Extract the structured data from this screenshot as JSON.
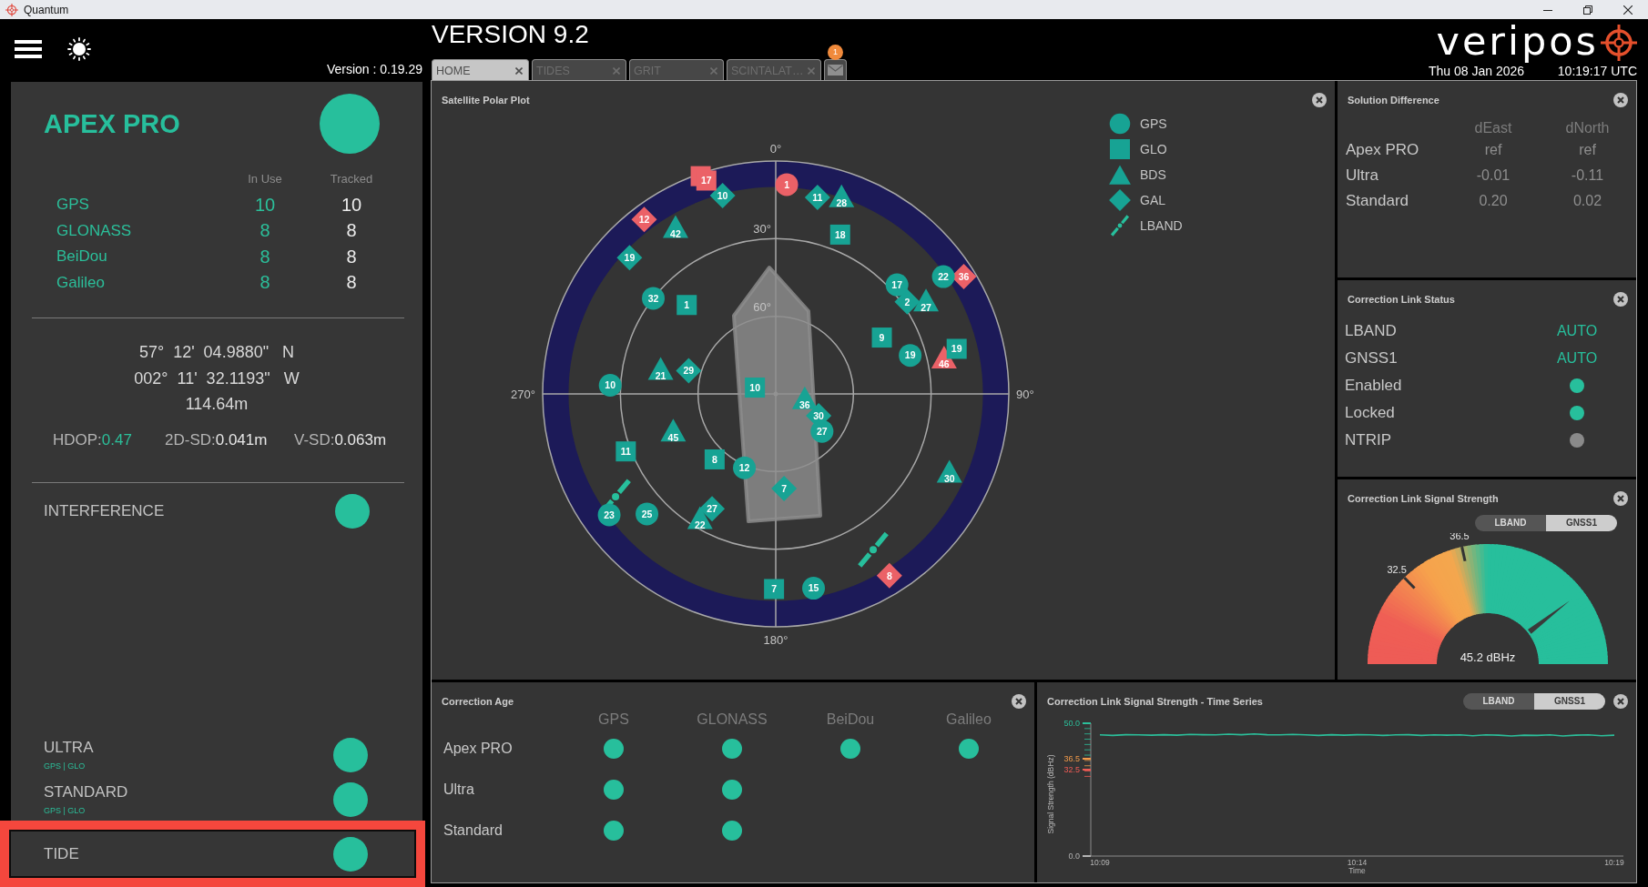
{
  "window": {
    "title": "Quantum"
  },
  "header": {
    "version": "Version : 0.19.29",
    "title": "VERSION 9.2",
    "tabs": [
      {
        "label": "HOME",
        "selected": true
      },
      {
        "label": "TIDES",
        "selected": false
      },
      {
        "label": "GRIT",
        "selected": false
      },
      {
        "label": "SCINTALAT…",
        "selected": false
      }
    ],
    "messages": {
      "badge": "1"
    },
    "logo": "veripos",
    "date": "Thu 08 Jan 2026",
    "time": "10:19:17 UTC"
  },
  "receiver": {
    "name": "APEX PRO",
    "on": true,
    "columns": [
      "In Use",
      "Tracked"
    ],
    "constellations": [
      {
        "name": "GPS",
        "in_use": "10",
        "tracked": "10"
      },
      {
        "name": "GLONASS",
        "in_use": "8",
        "tracked": "8"
      },
      {
        "name": "BeiDou",
        "in_use": "8",
        "tracked": "8"
      },
      {
        "name": "Galileo",
        "in_use": "8",
        "tracked": "8"
      }
    ],
    "position": [
      "57°  12'  04.9880\"   N",
      "002°  11'  32.1193\"   W",
      "114.64m"
    ],
    "metrics": [
      {
        "label": "HDOP:",
        "value": "0.47",
        "color": "#2bbf9a"
      },
      {
        "label": "2D-SD:",
        "value": "0.041m",
        "color": "#e6e6e6"
      },
      {
        "label": "V-SD:",
        "value": "0.063m",
        "color": "#e6e6e6"
      }
    ]
  },
  "interference": {
    "name": "INTERFERENCE",
    "on": true
  },
  "services": [
    {
      "name": "ULTRA",
      "systems": "GPS | GLO",
      "on": true
    },
    {
      "name": "STANDARD",
      "systems": "GPS | GLO",
      "on": true
    }
  ],
  "tide": {
    "name": "TIDE",
    "on": true,
    "highlighted": true
  },
  "polar": {
    "title": "Satellite Polar Plot",
    "azimuth_labels": [
      "0°",
      "90°",
      "180°",
      "270°"
    ],
    "elevation_labels": [
      "30°",
      "60°"
    ],
    "legend": [
      {
        "label": "GPS",
        "kind": "circle",
        "color": "#17a394"
      },
      {
        "label": "GLO",
        "kind": "square",
        "color": "#17a394"
      },
      {
        "label": "BDS",
        "kind": "triangle",
        "color": "#17a394"
      },
      {
        "label": "GAL",
        "kind": "diamond",
        "color": "#17a394"
      },
      {
        "label": "LBAND",
        "kind": "satellite",
        "color": "#27bf9c"
      }
    ],
    "satellites": [
      {
        "kind": "square",
        "color": "#eb6167"
      },
      {
        "kind": "satellite",
        "color": "#27bf9c"
      },
      {
        "kind": "satellite",
        "color": "#27bf9c"
      },
      {
        "kind": "diamond",
        "label": "12",
        "color": "#eb6167"
      },
      {
        "kind": "diamond",
        "label": "36",
        "color": "#eb6167"
      },
      {
        "kind": "diamond",
        "label": "8",
        "color": "#eb6167"
      },
      {
        "kind": "diamond",
        "label": "10",
        "color": "#17a394"
      },
      {
        "kind": "diamond",
        "label": "11",
        "color": "#17a394"
      },
      {
        "kind": "diamond",
        "label": "19",
        "color": "#17a394"
      },
      {
        "kind": "diamond",
        "label": "2",
        "color": "#17a394"
      },
      {
        "kind": "diamond",
        "label": "29",
        "color": "#17a394"
      },
      {
        "kind": "diamond",
        "label": "30",
        "color": "#17a394"
      },
      {
        "kind": "diamond",
        "label": "7",
        "color": "#17a394"
      },
      {
        "kind": "diamond",
        "label": "27",
        "color": "#17a394"
      },
      {
        "kind": "triangle",
        "label": "46",
        "color": "#eb6167"
      },
      {
        "kind": "triangle",
        "label": "28",
        "color": "#17a394"
      },
      {
        "kind": "triangle",
        "label": "42",
        "color": "#17a394"
      },
      {
        "kind": "triangle",
        "label": "27",
        "color": "#17a394"
      },
      {
        "kind": "triangle",
        "label": "21",
        "color": "#17a394"
      },
      {
        "kind": "triangle",
        "label": "36",
        "color": "#17a394"
      },
      {
        "kind": "triangle",
        "label": "45",
        "color": "#17a394"
      },
      {
        "kind": "triangle",
        "label": "22",
        "color": "#17a394"
      },
      {
        "kind": "triangle",
        "label": "30",
        "color": "#17a394"
      },
      {
        "kind": "square",
        "label": "17",
        "color": "#eb6167"
      },
      {
        "kind": "square",
        "label": "18",
        "color": "#17a394"
      },
      {
        "kind": "square",
        "label": "1",
        "color": "#17a394"
      },
      {
        "kind": "square",
        "label": "9",
        "color": "#17a394"
      },
      {
        "kind": "square",
        "label": "19",
        "color": "#17a394"
      },
      {
        "kind": "square",
        "label": "10",
        "color": "#17a394"
      },
      {
        "kind": "square",
        "label": "11",
        "color": "#17a394"
      },
      {
        "kind": "square",
        "label": "8",
        "color": "#17a394"
      },
      {
        "kind": "square",
        "label": "7",
        "color": "#17a394"
      },
      {
        "kind": "circle",
        "label": "1",
        "color": "#eb6167"
      },
      {
        "kind": "circle",
        "label": "32",
        "color": "#17a394"
      },
      {
        "kind": "circle",
        "label": "17",
        "color": "#17a394"
      },
      {
        "kind": "circle",
        "label": "22",
        "color": "#17a394"
      },
      {
        "kind": "circle",
        "label": "19",
        "color": "#17a394"
      },
      {
        "kind": "circle",
        "label": "10",
        "color": "#17a394"
      },
      {
        "kind": "circle",
        "label": "27",
        "color": "#17a394"
      },
      {
        "kind": "circle",
        "label": "12",
        "color": "#17a394"
      },
      {
        "kind": "circle",
        "label": "23",
        "color": "#17a394"
      },
      {
        "kind": "circle",
        "label": "25",
        "color": "#17a394"
      },
      {
        "kind": "circle",
        "label": "15",
        "color": "#17a394"
      }
    ]
  },
  "solution_difference": {
    "title": "Solution Difference",
    "columns": [
      "dEast",
      "dNorth"
    ],
    "rows": [
      {
        "label": "Apex PRO",
        "values": [
          "ref",
          "ref"
        ]
      },
      {
        "label": "Ultra",
        "values": [
          "-0.01",
          "-0.11"
        ]
      },
      {
        "label": "Standard",
        "values": [
          "0.20",
          "0.02"
        ]
      }
    ]
  },
  "link_status": {
    "title": "Correction Link Status",
    "rows": [
      {
        "kind": "text",
        "label": "LBAND",
        "value": "AUTO"
      },
      {
        "kind": "text",
        "label": "GNSS1",
        "value": "AUTO"
      },
      {
        "kind": "dot",
        "label": "Enabled",
        "on": true
      },
      {
        "kind": "dot",
        "label": "Locked",
        "on": true
      },
      {
        "kind": "dot",
        "label": "NTRIP",
        "on": false
      }
    ]
  },
  "signal_strength": {
    "title": "Correction Link Signal Strength",
    "sources": [
      {
        "label": "LBAND",
        "selected": false
      },
      {
        "label": "GNSS1",
        "selected": true
      }
    ],
    "gauge": {
      "level": 0.79,
      "reading": "45.2 dBHz",
      "ticks": [
        {
          "label": "32.5",
          "level": 0.256
        },
        {
          "label": "36.5",
          "level": 0.431
        }
      ]
    }
  },
  "correction_age": {
    "title": "Correction Age",
    "columns": [
      "GPS",
      "GLONASS",
      "BeiDou",
      "Galileo"
    ],
    "rows": [
      {
        "label": "Apex PRO",
        "cells": [
          {
            "on": true
          },
          {
            "on": true
          },
          {
            "on": true
          },
          {
            "on": true
          }
        ]
      },
      {
        "label": "Ultra",
        "cells": [
          {
            "on": true
          },
          {
            "on": true
          },
          {
            "on": false
          },
          {
            "on": false
          }
        ]
      },
      {
        "label": "Standard",
        "cells": [
          {
            "on": true
          },
          {
            "on": true
          },
          {
            "on": false
          },
          {
            "on": false
          }
        ]
      }
    ]
  },
  "time_series": {
    "title": "Correction Link Signal Strength - Time Series",
    "sources": [
      {
        "label": "LBAND",
        "selected": false
      },
      {
        "label": "GNSS1",
        "selected": true
      }
    ],
    "ytick_marks": [
      {
        "color": "#2bbf9a"
      },
      {
        "color": "#f29a4a"
      },
      {
        "color": "#ee5b55"
      },
      {
        "color": "#b4b4b4"
      }
    ],
    "chart_data": {
      "type": "line",
      "xlabel": "Time",
      "ylabel": "Signal Strength (dBHz)",
      "categories": [
        "10:09",
        null,
        null,
        null,
        null,
        null,
        null,
        null,
        null,
        null,
        null,
        null,
        null,
        null,
        null,
        null,
        null,
        null,
        null,
        null,
        "10:14",
        null,
        null,
        null,
        null,
        null,
        null,
        null,
        null,
        null,
        null,
        null,
        null,
        null,
        null,
        null,
        null,
        null,
        null,
        null,
        "10:19"
      ],
      "ylim": [
        0,
        50
      ],
      "yticks": [
        {
          "value": 50,
          "label": "50.0"
        },
        {
          "value": 36.5,
          "label": "36.5"
        },
        {
          "value": 32.5,
          "label": "32.5"
        },
        {
          "value": 0,
          "label": "0.0"
        }
      ],
      "series": [
        {
          "color": "#2bbf9a",
          "values": [
            45.6,
            45.4,
            45.7,
            45.6,
            45.5,
            45.7,
            45.5,
            45.8,
            45.7,
            45.6,
            45.9,
            45.7,
            46.0,
            45.7,
            45.6,
            45.8,
            45.6,
            45.4,
            45.7,
            45.5,
            45.7,
            45.6,
            45.4,
            45.6,
            45.7,
            45.4,
            45.6,
            45.5,
            45.6,
            45.3,
            45.6,
            45.5,
            45.2,
            45.5,
            45.4,
            45.6,
            45.2,
            45.5,
            45.6,
            45.3,
            45.5
          ]
        }
      ]
    }
  }
}
